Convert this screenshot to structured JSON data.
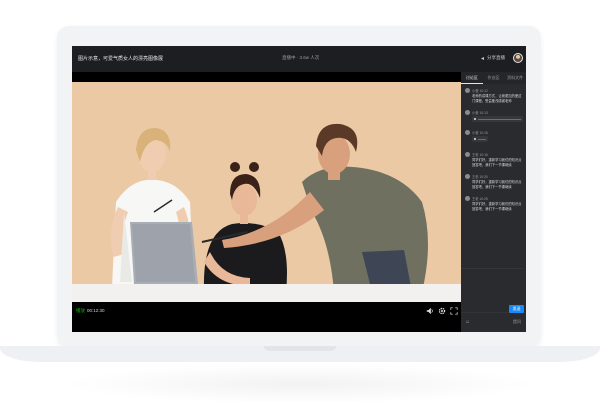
{
  "topbar": {
    "title": "图片示意，可爱气质女人的漂亮图像展",
    "meta": "直播中 · 3.6w 人次",
    "action_label": "分享直播"
  },
  "player": {
    "play_label": "播放",
    "time": "00:12:30"
  },
  "panel": {
    "tabs": [
      "讨论区",
      "作业区",
      "资料文件"
    ],
    "messages": [
      {
        "name": "小莹 10:12",
        "text": "老师的讲课方式，让我更加热爱这门课程，受益匪浅感谢老师",
        "type": "text"
      },
      {
        "name": "小莹 10:13",
        "text": "",
        "type": "voice"
      },
      {
        "name": "小莹 10:15",
        "text": "",
        "type": "voice"
      },
      {
        "name": "王老 10:16",
        "text": "同学们好，重新学习我们的知识点回答吧，我们下一节课继续",
        "type": "text"
      },
      {
        "name": "王老 10:20",
        "text": "同学们好，重新学习我们的知识点回答吧，我们下一节课继续",
        "type": "text"
      },
      {
        "name": "王老 10:25",
        "text": "同学们好，重新学习我们的知识点回答吧，我们下一节课继续",
        "type": "text"
      }
    ],
    "composer_tip": "提问",
    "send_label": "发送"
  },
  "colors": {
    "accent": "#1989fa",
    "play_green": "#1aad19",
    "backdrop": "#ecc9a5"
  }
}
